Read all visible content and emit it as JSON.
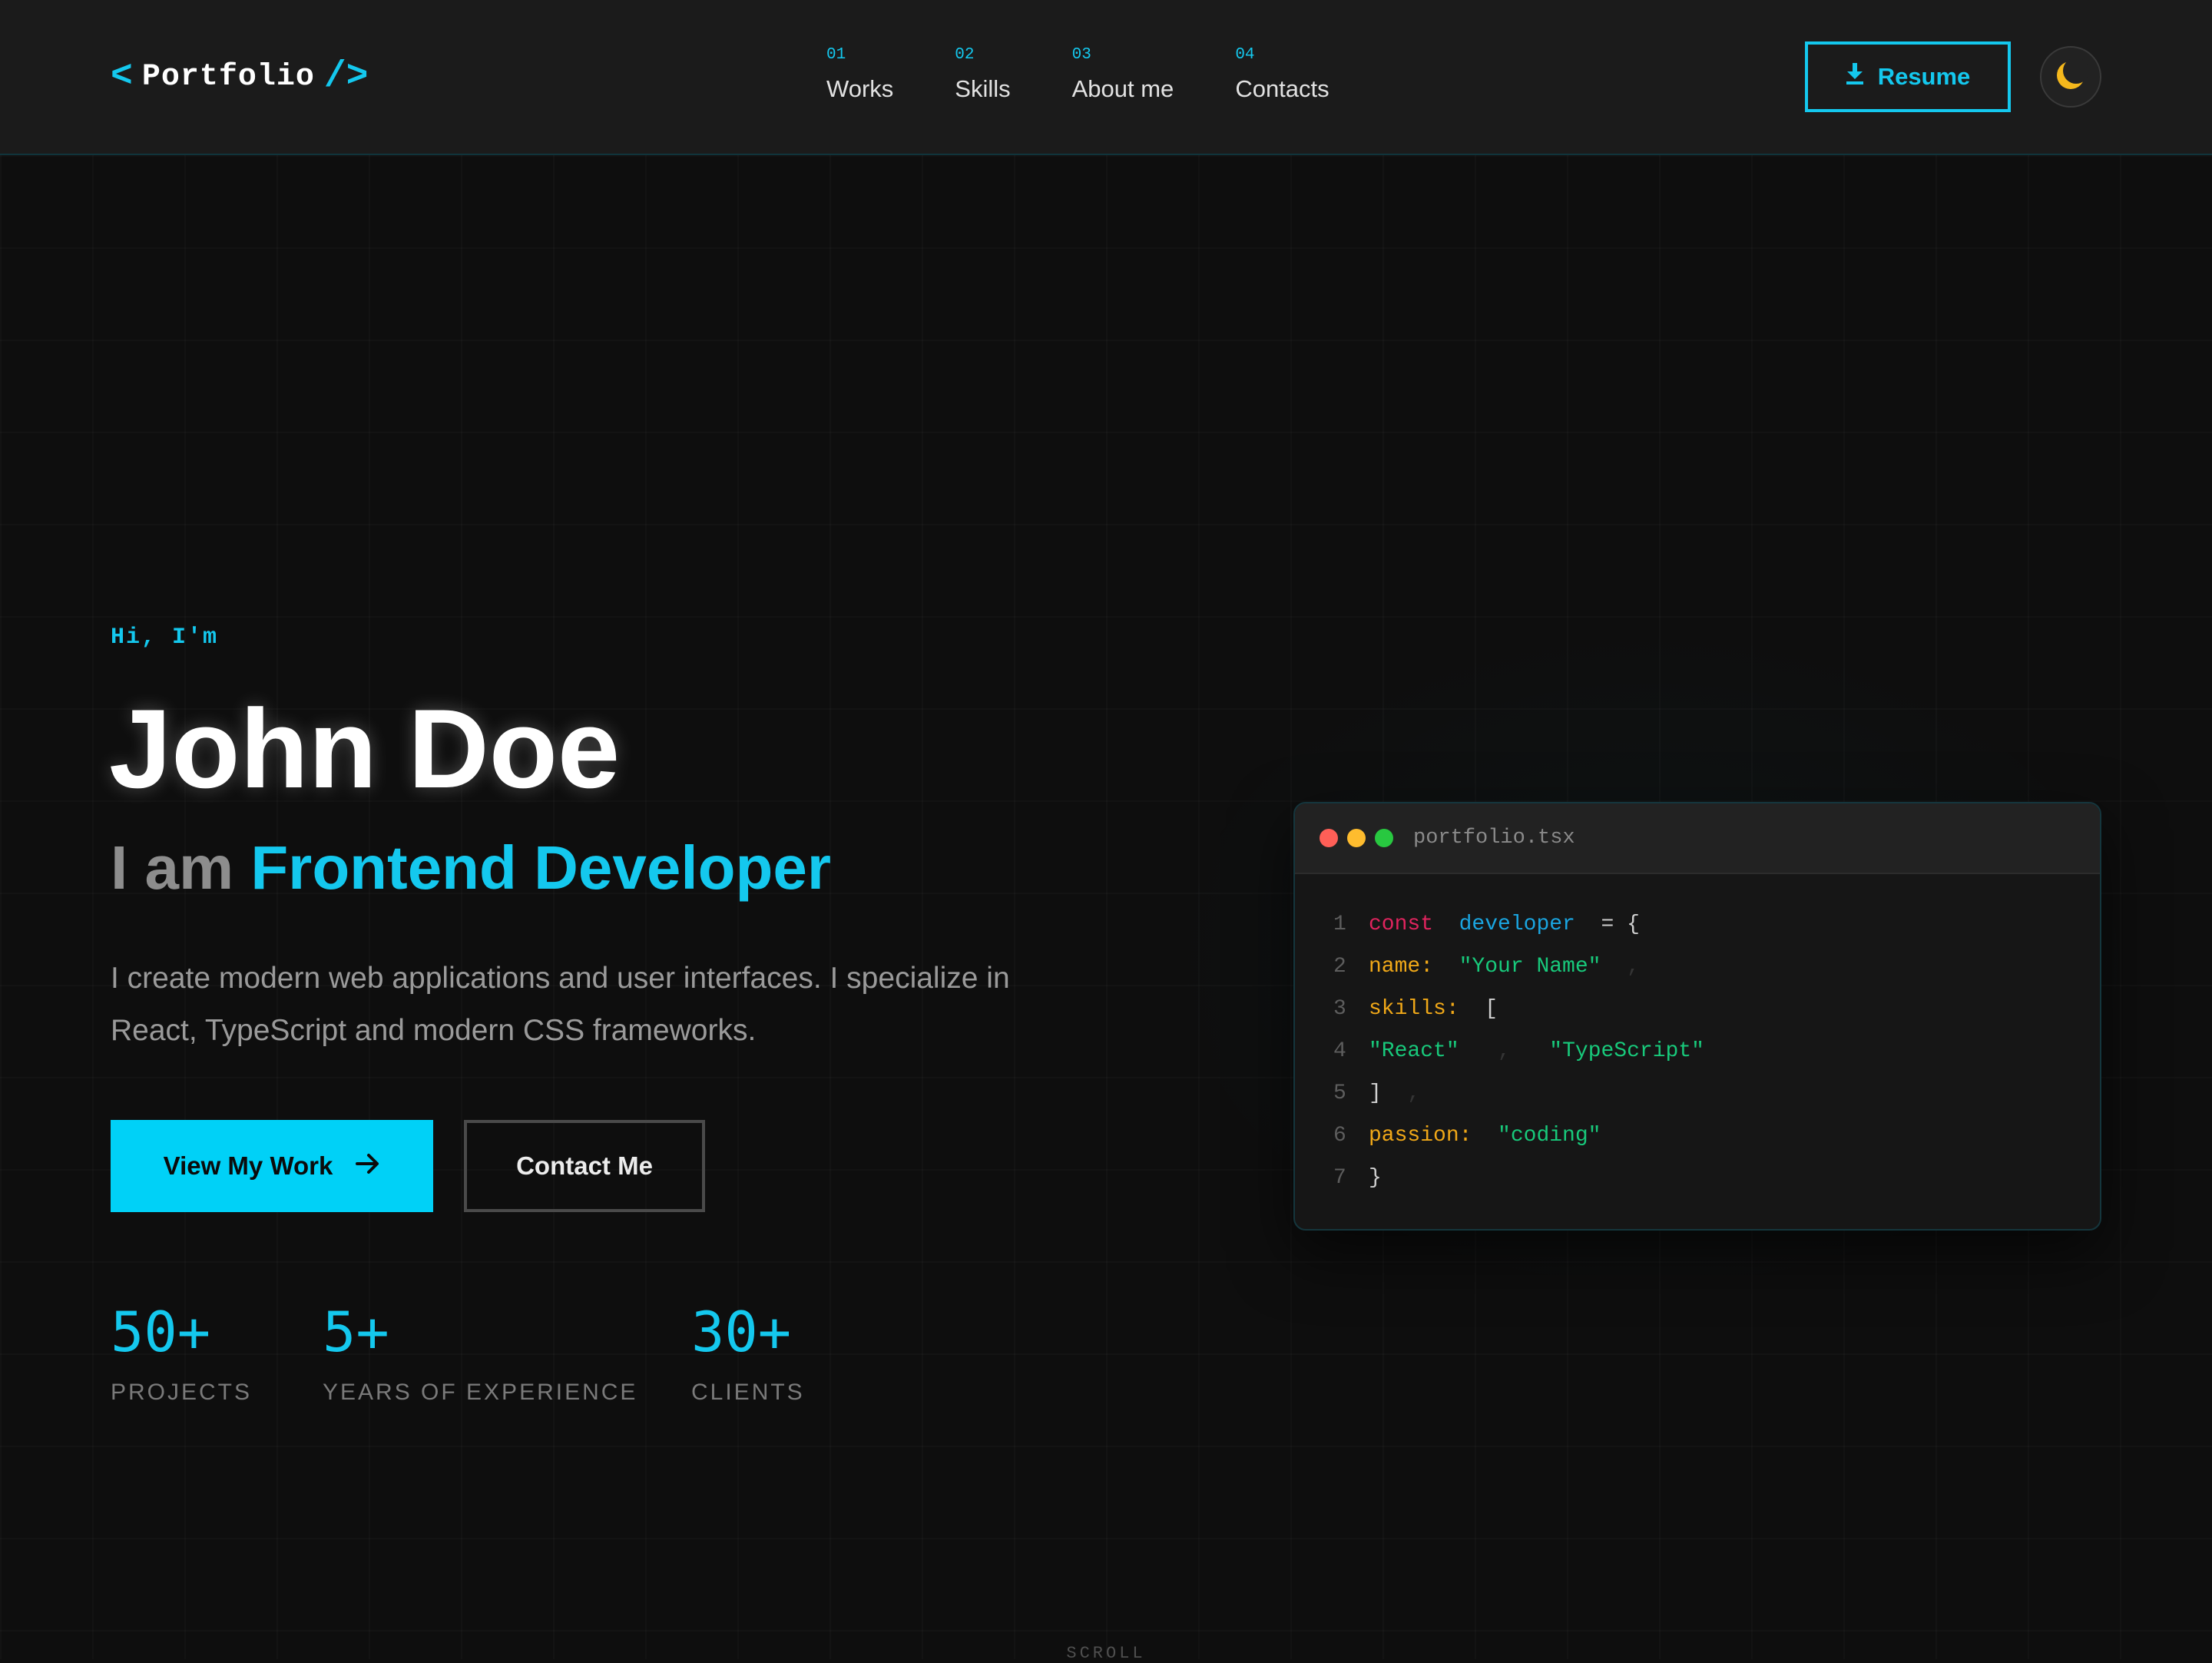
{
  "header": {
    "logo": {
      "open": "<",
      "name": "Portfolio",
      "close": "/>"
    },
    "nav": [
      {
        "num": "01",
        "label": "Works"
      },
      {
        "num": "02",
        "label": "Skills"
      },
      {
        "num": "03",
        "label": "About me"
      },
      {
        "num": "04",
        "label": "Contacts"
      }
    ],
    "resume_label": "Resume"
  },
  "hero": {
    "greeting": "Hi, I'm",
    "name": "John Doe",
    "role_prefix": "I am",
    "role_title": "Frontend Developer",
    "description": "I create modern web applications and user interfaces. I specialize in React, TypeScript and modern CSS frameworks.",
    "primary_button": "View My Work",
    "secondary_button": "Contact Me",
    "stats": [
      {
        "value": "50+",
        "label": "PROJECTS"
      },
      {
        "value": "5+",
        "label": "YEARS OF EXPERIENCE"
      },
      {
        "value": "30+",
        "label": "CLIENTS"
      }
    ]
  },
  "code_window": {
    "filename": "portfolio.tsx",
    "lines": [
      {
        "num": "1",
        "kw": "const",
        "var": "developer",
        "op": "= {"
      },
      {
        "num": "2",
        "key": "name:",
        "val": "\"Your Name\"",
        "trail": ","
      },
      {
        "num": "3",
        "key": "skills:",
        "op": "["
      },
      {
        "num": "4",
        "item1": "\"React\"",
        "sep": ",",
        "item2": "\"TypeScript\""
      },
      {
        "num": "5",
        "close": "]",
        "trail": ","
      },
      {
        "num": "6",
        "key": "passion:",
        "val": "\"coding\""
      },
      {
        "num": "7",
        "close": "}"
      }
    ]
  },
  "scroll_label": "SCROLL",
  "colors": {
    "accent": "#14c8ee",
    "background": "#0e0e0e",
    "header_bg": "#1b1b1b",
    "keyword": "#e0245e",
    "variable": "#1aa5e0",
    "property": "#f0a818",
    "string": "#18c97b",
    "moon": "#f5b81c"
  },
  "icons": {
    "resume": "download-icon",
    "primary_button": "arrow-right-icon",
    "theme": "moon-icon"
  }
}
